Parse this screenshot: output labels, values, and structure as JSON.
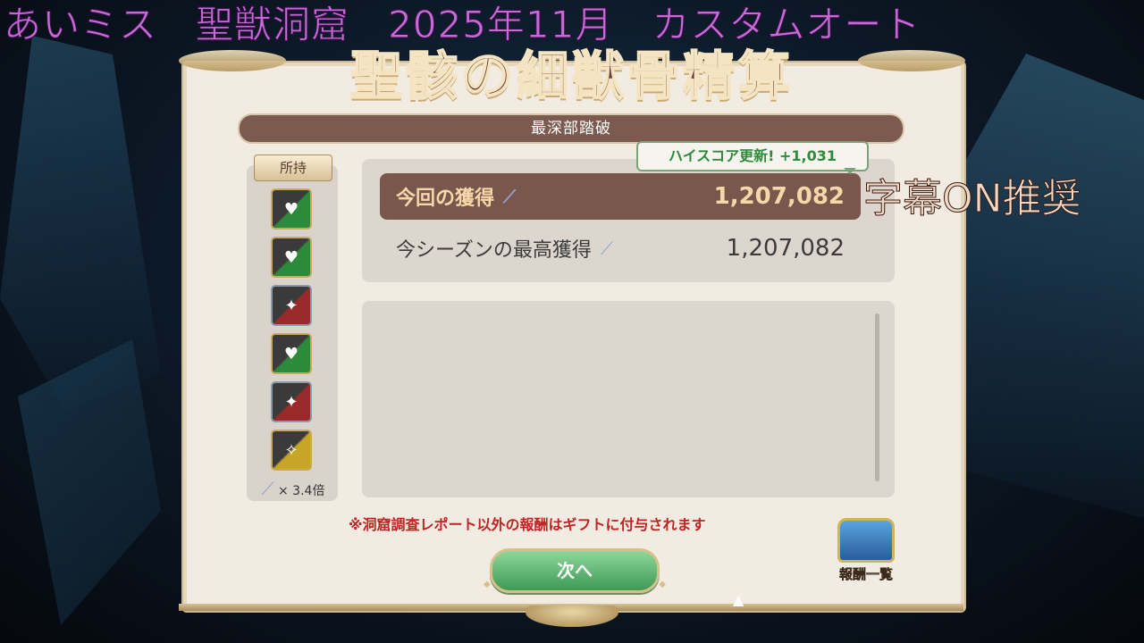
{
  "overlay": {
    "title": "あいミス　聖獣洞窟　2025年11月　カスタムオート",
    "subtitle_note": "字幕ON推奨"
  },
  "panel": {
    "title": "聖骸の細獣骨精算",
    "section": "最深部踏破"
  },
  "inventory": {
    "label": "所持",
    "items": [
      {
        "icon": "green-card-icon",
        "symbol": "♥"
      },
      {
        "icon": "green-card-icon",
        "symbol": "♥"
      },
      {
        "icon": "red-card-icon",
        "symbol": "✦"
      },
      {
        "icon": "green-card-icon",
        "symbol": "♥"
      },
      {
        "icon": "red-card-icon",
        "symbol": "✦"
      },
      {
        "icon": "gold-card-icon",
        "symbol": "✧"
      }
    ],
    "multiplier": "× 3.4倍"
  },
  "scores": {
    "highscore_badge": "ハイスコア更新! +1,031",
    "current_label": "今回の獲得",
    "current_value": "1,207,082",
    "best_label": "今シーズンの最高獲得",
    "best_value": "1,207,082"
  },
  "notice": "※洞窟調査レポート以外の報酬はギフトに付与されます",
  "buttons": {
    "next": "次へ",
    "reward_list": "報酬一覧"
  }
}
